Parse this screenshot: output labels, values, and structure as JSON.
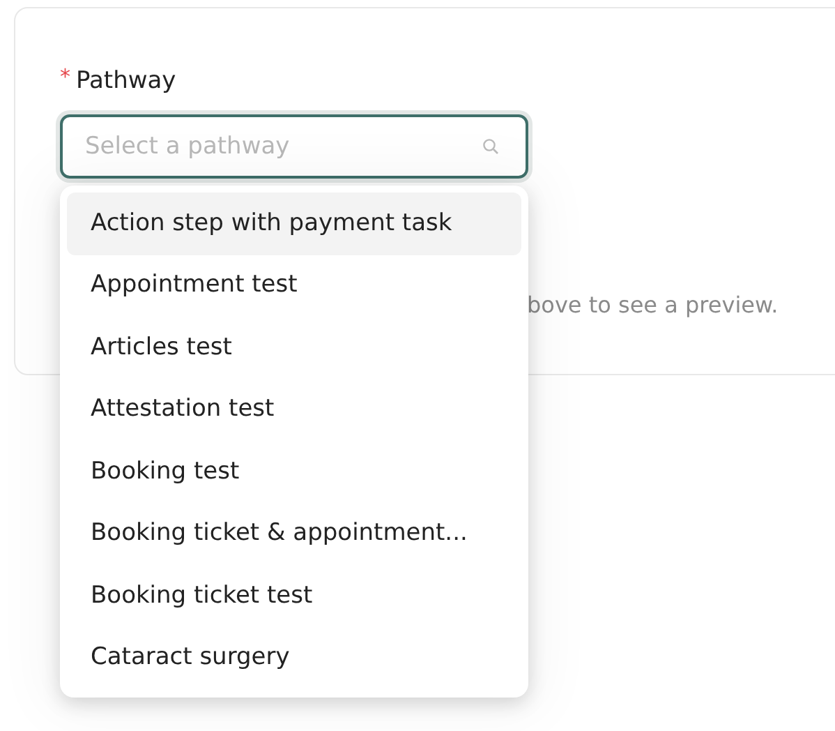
{
  "field": {
    "required_mark": "*",
    "label": "Pathway",
    "placeholder": "Select a pathway"
  },
  "preview_hint": "bove to see a preview.",
  "dropdown": {
    "options": [
      {
        "label": "Action step with payment task",
        "selected": true
      },
      {
        "label": "Appointment test",
        "selected": false
      },
      {
        "label": "Articles test",
        "selected": false
      },
      {
        "label": "Attestation test",
        "selected": false
      },
      {
        "label": "Booking test",
        "selected": false
      },
      {
        "label": "Booking ticket & appointment...",
        "selected": false
      },
      {
        "label": "Booking ticket test",
        "selected": false
      },
      {
        "label": "Cataract surgery",
        "selected": false
      }
    ]
  }
}
